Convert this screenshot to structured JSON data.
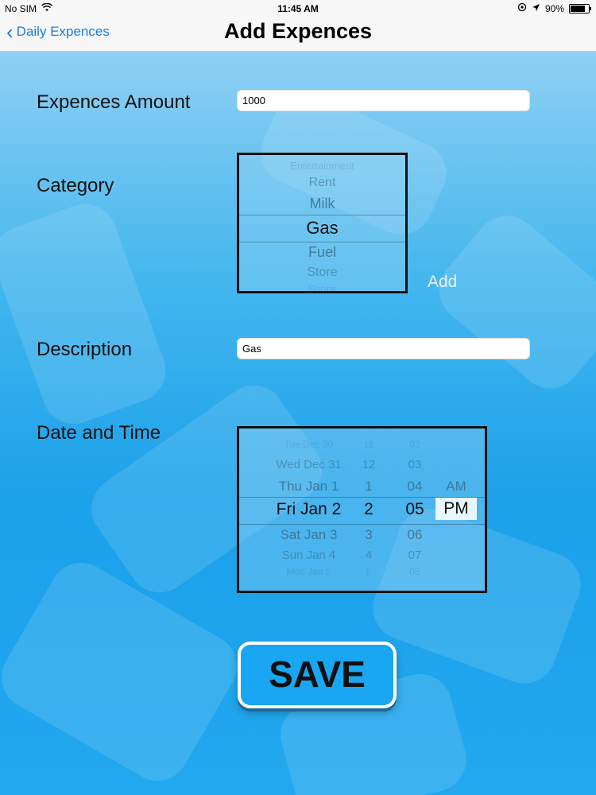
{
  "status_bar": {
    "carrier": "No SIM",
    "time": "11:45 AM",
    "battery": "90%",
    "battery_fraction": 0.9
  },
  "nav": {
    "back_label": "Daily Expences",
    "title": "Add Expences"
  },
  "form": {
    "amount_label": "Expences Amount",
    "amount_value": "1000",
    "category_label": "Category",
    "category_picker": {
      "items": [
        "Entertainment",
        "Rent",
        "Milk",
        "Gas",
        "Fuel",
        "Store",
        "Shops"
      ],
      "selected": "Gas"
    },
    "add_label": "Add",
    "description_label": "Description",
    "description_value": "Gas",
    "datetime_label": "Date and Time",
    "date_picker": {
      "days": [
        "Tue Dec 30",
        "Wed Dec 31",
        "Thu Jan 1",
        "Fri Jan 2",
        "Sat Jan 3",
        "Sun Jan 4",
        "Mon Jan 5"
      ],
      "hours": [
        "11",
        "12",
        "1",
        "2",
        "3",
        "4",
        "5"
      ],
      "minutes": [
        "02",
        "03",
        "04",
        "05",
        "06",
        "07",
        "08"
      ],
      "ampm": [
        "AM",
        "PM"
      ],
      "selected": {
        "day": "Fri Jan 2",
        "hour": "2",
        "minute": "05",
        "ampm": "PM"
      }
    },
    "save_label": "SAVE"
  }
}
